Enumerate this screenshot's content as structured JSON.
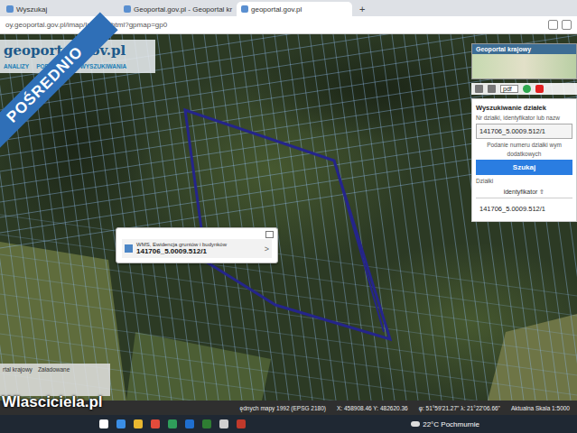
{
  "browser": {
    "tabs": [
      {
        "label": "Wyszukaj",
        "selected": false
      },
      {
        "label": "Geoportal.gov.pl - Geoportal kr",
        "selected": false
      },
      {
        "label": "geoportal.gov.pl",
        "selected": true
      }
    ],
    "new_tab": "+",
    "address": "oy.geoportal.gov.pl/imap/Imgp_2.html?gpmap=gp0"
  },
  "ribbon": "POŚREDNIO",
  "logo": "geoportal.gov.pl",
  "menu": [
    "ANALIZY",
    "POBIERANIE",
    "WYSZUKIWANIA"
  ],
  "minimap": {
    "label": "Geoportal krajowy"
  },
  "toolbar": {
    "format": "pdf"
  },
  "search_panel": {
    "title": "Wyszukiwanie działek",
    "field_label": "Nr działki, identyfikator lub nazw",
    "field_value": "141706_5.0009.512/1",
    "hint": [
      "Podanie numeru działki wym",
      "dodatkowych"
    ],
    "button": "Szukaj",
    "results_label": "Działki",
    "column": "identyfikator ⇧",
    "results": [
      "141706_5.0009.512/1"
    ]
  },
  "popup": {
    "layer": "WMS, Ewidencja gruntów i budynków",
    "parcel": "141706_5.0009.512/1",
    "more": ">"
  },
  "layers_box": {
    "tabs": [
      "rtal krajowy",
      "Załadowane"
    ]
  },
  "status_bar": [
    "ędnych mapy 1992 (EPSG 2180)",
    "X: 458908.46 Y: 482620.36",
    "φ: 51°59'21.27\" λ: 21°22'06.66\"",
    "Aktualna Skala 1:5000"
  ],
  "watermark": "Wlasciciela.pl",
  "taskbar": {
    "weather": "22°C Pochmurnie"
  }
}
